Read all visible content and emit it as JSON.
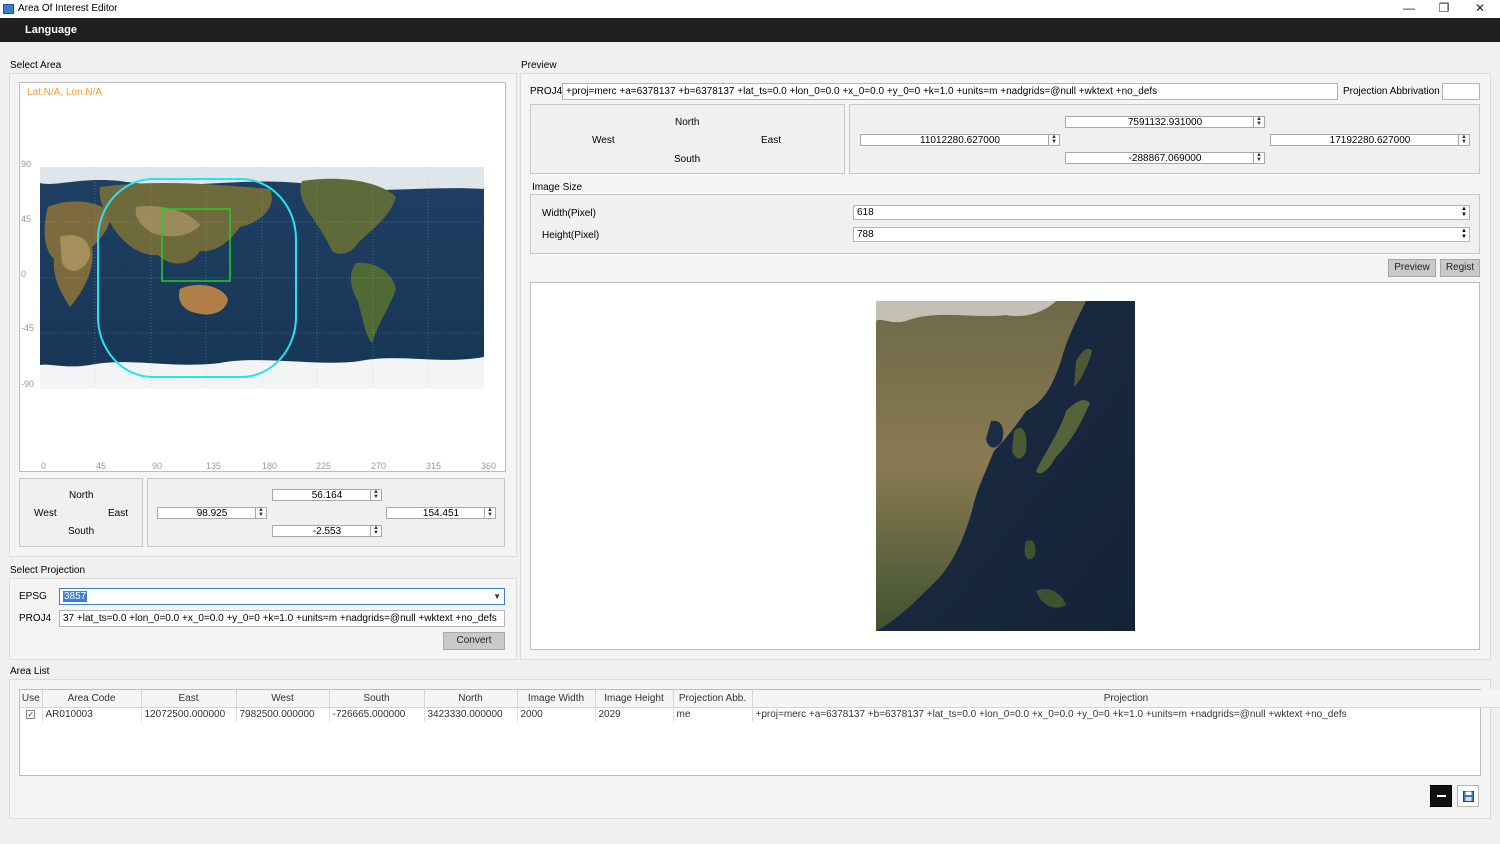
{
  "window": {
    "title": "Area Of Interest Editor",
    "minimize": "—",
    "maximize": "❐",
    "close": "✕"
  },
  "menubar": {
    "language": "Language"
  },
  "select_area": {
    "label": "Select Area",
    "latlon": "Lat:N/A, Lon:N/A",
    "y_ticks": [
      "90",
      "45",
      "0",
      "-45",
      "-90"
    ],
    "x_ticks": [
      "0",
      "45",
      "90",
      "135",
      "180",
      "225",
      "270",
      "315",
      "360"
    ],
    "north_label": "North",
    "west_label": "West",
    "east_label": "East",
    "south_label": "South",
    "north": "56.164",
    "west": "98.925",
    "east": "154.451",
    "south": "-2.553",
    "colors": {
      "selection_rect": "#1fd11f",
      "projection_outline": "#27e3ef",
      "latlon_text": "#f39c34"
    }
  },
  "select_projection": {
    "label": "Select Projection",
    "epsg_label": "EPSG",
    "epsg_value": "3857",
    "proj4_label": "PROJ4",
    "proj4_value": "37 +lat_ts=0.0 +lon_0=0.0 +x_0=0.0 +y_0=0 +k=1.0 +units=m +nadgrids=@null +wktext  +no_defs",
    "convert": "Convert"
  },
  "preview": {
    "label": "Preview",
    "proj4_label": "PROJ4",
    "proj4_value": "+proj=merc +a=6378137 +b=6378137 +lat_ts=0.0 +lon_0=0.0 +x_0=0.0 +y_0=0 +k=1.0 +units=m +nadgrids=@null +wktext  +no_defs",
    "proj_abbr_label": "Projection Abbrivation",
    "proj_abbr_value": "",
    "north_label": "North",
    "west_label": "West",
    "east_label": "East",
    "south_label": "South",
    "north": "7591132.931000",
    "west": "11012280.627000",
    "east": "17192280.627000",
    "south": "-288867.069000",
    "image_size_label": "Image Size",
    "width_label": "Width(Pixel)",
    "width_value": "618",
    "height_label": "Height(Pixel)",
    "height_value": "788",
    "preview_btn": "Preview",
    "regist_btn": "Regist"
  },
  "area_list": {
    "label": "Area List",
    "columns": [
      "Use",
      "Area Code",
      "East",
      "West",
      "South",
      "North",
      "Image Width",
      "Image Height",
      "Projection Abb.",
      "Projection"
    ],
    "rows": [
      {
        "use": "✓",
        "area_code": "AR010003",
        "east": "12072500.000000",
        "west": "7982500.000000",
        "south": "-726665.000000",
        "north": "3423330.000000",
        "image_width": "2000",
        "image_height": "2029",
        "proj_abb": "me",
        "projection": "+proj=merc +a=6378137 +b=6378137 +lat_ts=0.0 +lon_0=0.0 +x_0=0.0 +y_0=0 +k=1.0 +units=m +nadgrids=@null +wktext  +no_defs"
      }
    ]
  }
}
